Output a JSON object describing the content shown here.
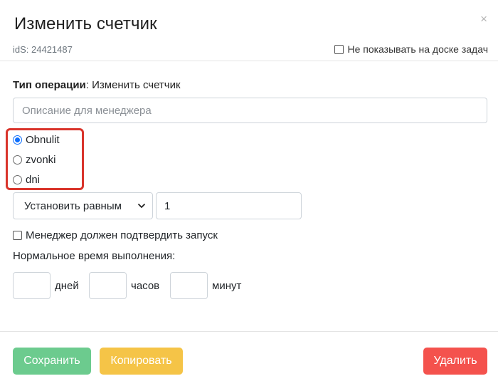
{
  "header": {
    "title": "Изменить счетчик",
    "close_icon": "×",
    "ids_label": "idS: 24421487",
    "hide_board_label": "Не показывать на доске задач",
    "hide_board_checked": false
  },
  "form": {
    "operation_type_label": "Тип операции",
    "operation_type_value": ": Изменить счетчик",
    "description_placeholder": "Описание для менеджера",
    "description_value": "",
    "counters": [
      {
        "label": "Obnulit",
        "checked": true
      },
      {
        "label": "zvonki",
        "checked": false
      },
      {
        "label": "dni",
        "checked": false
      }
    ],
    "action_select_value": "Установить равным",
    "action_value": "1",
    "confirm_label": "Менеджер должен подтвердить запуск",
    "confirm_checked": false,
    "normal_time_label": "Нормальное время выполнения:",
    "duration": {
      "days_label": "дней",
      "hours_label": "часов",
      "minutes_label": "минут",
      "days_value": "",
      "hours_value": "",
      "minutes_value": ""
    }
  },
  "footer": {
    "save_label": "Сохранить",
    "copy_label": "Копировать",
    "delete_label": "Удалить"
  },
  "colors": {
    "save": "#6ccb8e",
    "copy": "#f5c447",
    "delete": "#f4524d",
    "highlight": "#d9342b",
    "radio_accent": "#0d6efd"
  }
}
